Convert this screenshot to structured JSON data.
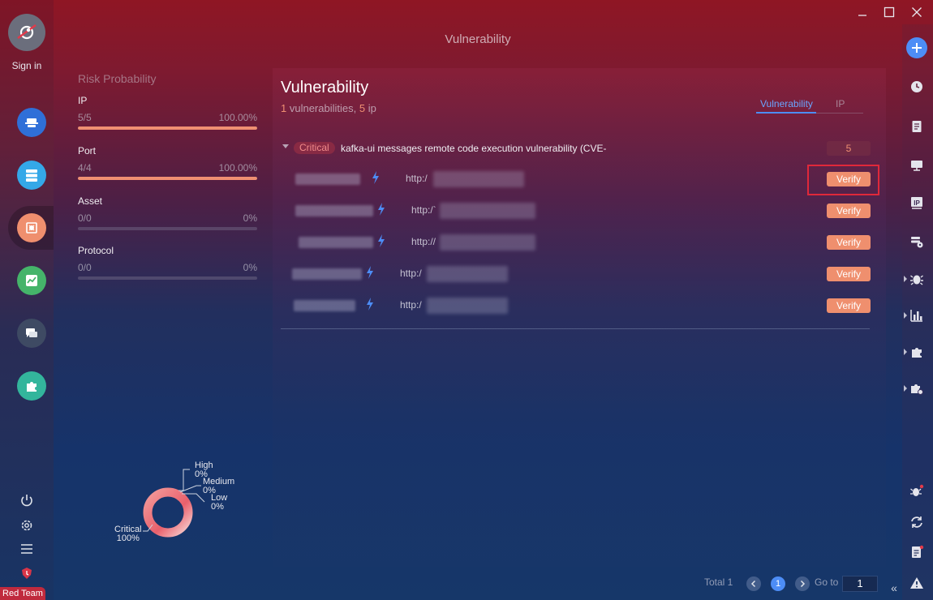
{
  "app": {
    "sign_in": "Sign in",
    "team_badge": "Red Team",
    "page_title": "Vulnerability"
  },
  "nav": {
    "items": [
      {
        "icon": "agent-icon",
        "color": "#2f6fd8"
      },
      {
        "icon": "server-icon",
        "color": "#34a8e8"
      },
      {
        "icon": "bug-report-icon",
        "color": "#ef8f6e",
        "active": true
      },
      {
        "icon": "chart-icon",
        "color": "#45b46a"
      },
      {
        "icon": "chat-icon",
        "color": "#3e4a63"
      },
      {
        "icon": "plugin-icon",
        "color": "#33b59c"
      }
    ]
  },
  "risk": {
    "title": "Risk Probability",
    "items": [
      {
        "name": "IP",
        "count": "5/5",
        "percent_text": "100.00%",
        "fraction": 1.0
      },
      {
        "name": "Port",
        "count": "4/4",
        "percent_text": "100.00%",
        "fraction": 1.0
      },
      {
        "name": "Asset",
        "count": "0/0",
        "percent_text": "0%",
        "fraction": 0
      },
      {
        "name": "Protocol",
        "count": "0/0",
        "percent_text": "0%",
        "fraction": 0
      }
    ]
  },
  "donut": {
    "segments": [
      {
        "name": "High",
        "percent": "0%"
      },
      {
        "name": "Medium",
        "percent": "0%"
      },
      {
        "name": "Low",
        "percent": "0%"
      },
      {
        "name": "Critical",
        "percent": "100%"
      }
    ]
  },
  "main": {
    "title": "Vulnerability",
    "sub_count_vuln": "1",
    "sub_vuln_label": " vulnerabilities, ",
    "sub_count_ip": "5",
    "sub_ip_label": " ip",
    "tabs": [
      {
        "label": "Vulnerability",
        "active": true
      },
      {
        "label": "IP",
        "active": false
      }
    ],
    "vulnerability": {
      "severity": "Critical",
      "name": "kafka-ui messages remote code execution vulnerability (CVE-",
      "count": "5"
    },
    "rows": [
      {
        "url_prefix": "http:/",
        "verify": "Verify"
      },
      {
        "url_prefix": "http:/`",
        "verify": "Verify"
      },
      {
        "url_prefix": "http://",
        "verify": "Verify"
      },
      {
        "url_prefix": "http:/",
        "verify": "Verify"
      },
      {
        "url_prefix": "http:/",
        "verify": "Verify"
      }
    ]
  },
  "pagination": {
    "total": "Total 1",
    "current_page": "1",
    "goto_label": "Go to",
    "goto_value": "1"
  },
  "colors": {
    "accent": "#ef8f6e",
    "critical": "#e0283a",
    "tab_active": "#6aa5ff"
  }
}
